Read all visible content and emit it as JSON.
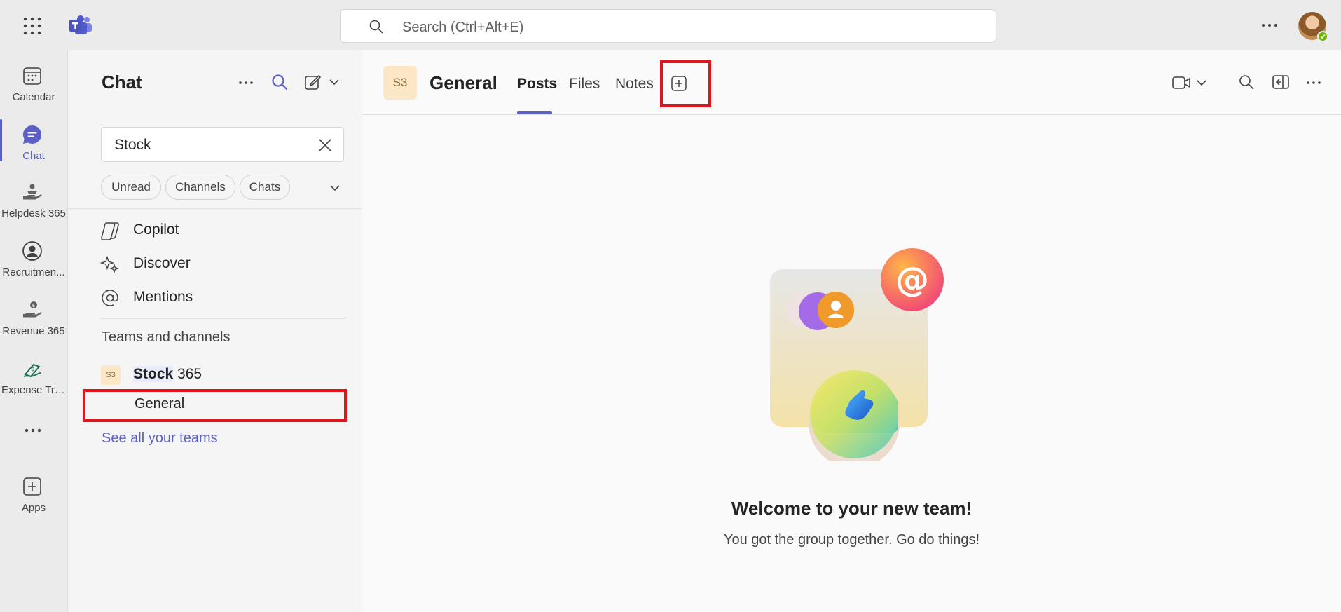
{
  "topbar": {
    "search_placeholder": "Search (Ctrl+Alt+E)"
  },
  "rail": {
    "items": [
      {
        "label": "Calendar",
        "icon": "calendar-icon"
      },
      {
        "label": "Chat",
        "icon": "chat-icon",
        "active": true
      },
      {
        "label": "Helpdesk 365",
        "icon": "helpdesk-icon"
      },
      {
        "label": "Recruitmen...",
        "icon": "recruitment-icon"
      },
      {
        "label": "Revenue 365",
        "icon": "revenue-icon"
      },
      {
        "label": "Expense Tra...",
        "icon": "expense-icon"
      },
      {
        "label": "Apps",
        "icon": "apps-icon"
      }
    ]
  },
  "panel": {
    "title": "Chat",
    "filter_value": "Stock",
    "chips": [
      "Unread",
      "Channels",
      "Chats"
    ],
    "nav": [
      {
        "label": "Copilot",
        "icon": "copilot-icon"
      },
      {
        "label": "Discover",
        "icon": "discover-icon"
      },
      {
        "label": "Mentions",
        "icon": "mention-icon"
      }
    ],
    "section_title": "Teams and channels",
    "team": {
      "badge": "S3",
      "name_bold": "Stock",
      "name_rest": " 365"
    },
    "channel": "General",
    "see_all": "See all your teams"
  },
  "main": {
    "badge": "S3",
    "title": "General",
    "tabs": [
      "Posts",
      "Files",
      "Notes"
    ],
    "active_tab": "Posts",
    "welcome_title": "Welcome to your new team!",
    "welcome_sub": "You got the group together. Go do things!"
  },
  "colors": {
    "accent": "#5b5fc7",
    "highlight_box": "#e3131b",
    "team_badge": "#fbe6c5"
  }
}
